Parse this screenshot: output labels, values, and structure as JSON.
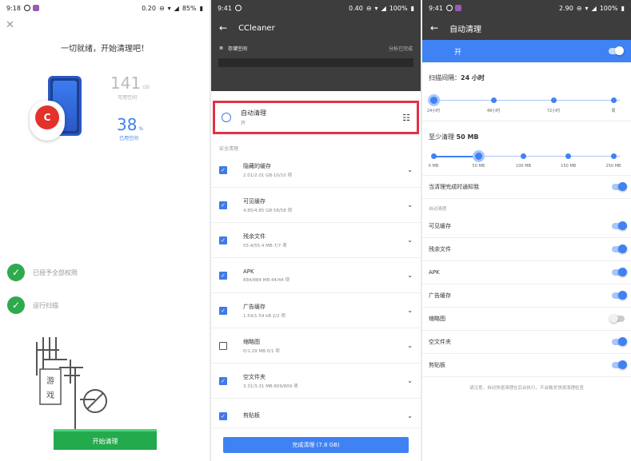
{
  "panel1": {
    "status": {
      "time": "9:18",
      "speed": "0.20",
      "battery": "85%"
    },
    "title": "一切就绪，开始清理吧！",
    "free_space": {
      "value": "141",
      "unit": "GB",
      "label": "可用空间"
    },
    "used_space": {
      "value": "38",
      "unit": "%",
      "label": "已用空间"
    },
    "checks": [
      "已授予全部权限",
      "运行扫描"
    ],
    "watermark_text": "游戏",
    "start_button": "开始清理",
    "colors": {
      "accent": "#22aa4c",
      "check": "#2eaa4d"
    }
  },
  "panel2": {
    "status": {
      "time": "9:41",
      "speed": "0.40",
      "battery": "100%"
    },
    "app_title": "CCleaner",
    "storage_label": "存储空间",
    "storage_status": "分析已完成",
    "auto_clean": {
      "title": "自动清理",
      "status": "开"
    },
    "section_header": "安全清理",
    "items": [
      {
        "name": "隐藏的缓存",
        "detail": "2.01/2.01 GB·10/10 项",
        "checked": true
      },
      {
        "name": "可见缓存",
        "detail": "4.85/4.85 GB·58/58 项",
        "checked": true
      },
      {
        "name": "残余文件",
        "detail": "55.4/55.4 MB·7/7 项",
        "checked": true
      },
      {
        "name": "APK",
        "detail": "884/884 MB·44/44 项",
        "checked": true
      },
      {
        "name": "广告缓存",
        "detail": "1.54/1.54 kB·2/2 项",
        "checked": true
      },
      {
        "name": "缩略图",
        "detail": "0/1.29 MB·0/1 项",
        "checked": false
      },
      {
        "name": "空文件夹",
        "detail": "3.31/3.31 MB·809/809 项",
        "checked": true
      },
      {
        "name": "剪贴板",
        "detail": "",
        "checked": true
      }
    ],
    "finish_button": "完成清理 (7.8 GB)",
    "colors": {
      "accent": "#3f82f3",
      "highlight": "#e03247"
    }
  },
  "panel3": {
    "status": {
      "time": "9:41",
      "speed": "2.90",
      "battery": "100%"
    },
    "title": "自动清理",
    "master": {
      "label": "开",
      "on": true
    },
    "interval": {
      "label": "扫描间隔：",
      "value": "24 小时",
      "stops": [
        "24小时",
        "48小时",
        "72小时",
        "周"
      ],
      "selected_index": 0
    },
    "min_clean": {
      "label": "至少清理",
      "value": "50 MB",
      "stops": [
        "0 MB",
        "50 MB",
        "100 MB",
        "150 MB",
        "250 MB"
      ],
      "selected_index": 1
    },
    "notify": {
      "label": "当清理完成时通知我",
      "on": true
    },
    "group_header": "自动清理",
    "toggles": [
      {
        "label": "可见缓存",
        "on": true
      },
      {
        "label": "残余文件",
        "on": true
      },
      {
        "label": "APK",
        "on": true
      },
      {
        "label": "广告缓存",
        "on": true
      },
      {
        "label": "缩略图",
        "on": false
      },
      {
        "label": "空文件夹",
        "on": true
      },
      {
        "label": "剪贴板",
        "on": true
      }
    ],
    "note": "请注意，自动快速清理在后台执行，不会触发快速清理检查"
  }
}
